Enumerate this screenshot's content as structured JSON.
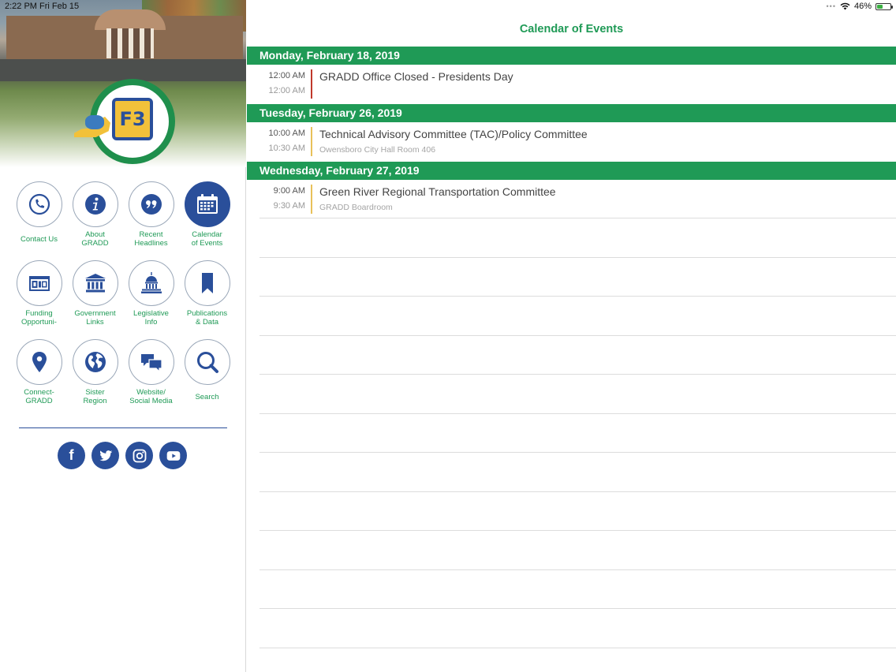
{
  "status": {
    "time": "2:22 PM",
    "date": "Fri Feb 15",
    "dots": "•••",
    "battery_pct": "46%",
    "battery_level": 0.46
  },
  "sidebar": {
    "logo_text": "F3",
    "tiles": [
      {
        "label": "Contact Us",
        "icon": "phone-icon"
      },
      {
        "label": "About\nGRADD",
        "icon": "info-icon"
      },
      {
        "label": "Recent\nHeadlines",
        "icon": "quote-icon"
      },
      {
        "label": "Calendar\nof Events",
        "icon": "calendar-icon"
      },
      {
        "label": "Funding\nOpportuni-",
        "icon": "funding-icon"
      },
      {
        "label": "Government\nLinks",
        "icon": "government-icon"
      },
      {
        "label": "Legislative\nInfo",
        "icon": "capitol-icon"
      },
      {
        "label": "Publications\n& Data",
        "icon": "bookmark-icon"
      },
      {
        "label": "Connect-\nGRADD",
        "icon": "location-pin-icon"
      },
      {
        "label": "Sister\nRegion",
        "icon": "globe-icon"
      },
      {
        "label": "Website/\nSocial Media",
        "icon": "chat-icon"
      },
      {
        "label": "Search",
        "icon": "search-icon"
      }
    ],
    "social": [
      {
        "name": "facebook",
        "glyph": "f"
      },
      {
        "name": "twitter",
        "glyph": ""
      },
      {
        "name": "instagram",
        "glyph": ""
      },
      {
        "name": "youtube",
        "glyph": ""
      }
    ]
  },
  "main": {
    "title": "Calendar of Events",
    "days": [
      {
        "header": "Monday, February 18, 2019",
        "events": [
          {
            "start": "12:00 AM",
            "end": "12:00 AM",
            "title": "GRADD Office Closed - Presidents Day",
            "location": "",
            "bar_color": "#c0392b"
          }
        ]
      },
      {
        "header": "Tuesday, February 26, 2019",
        "events": [
          {
            "start": "10:00 AM",
            "end": "10:30 AM",
            "title": "Technical Advisory Committee (TAC)/Policy Committee",
            "location": "Owensboro City Hall Room 406",
            "bar_color": "#e8c15a"
          }
        ]
      },
      {
        "header": "Wednesday, February 27, 2019",
        "events": [
          {
            "start": "9:00 AM",
            "end": "9:30 AM",
            "title": "Green River Regional Transportation Committee",
            "location": "GRADD Boardroom",
            "bar_color": "#e8c15a"
          }
        ]
      }
    ]
  },
  "colors": {
    "accent_green": "#1f9a56",
    "accent_blue": "#2a4f9a"
  }
}
